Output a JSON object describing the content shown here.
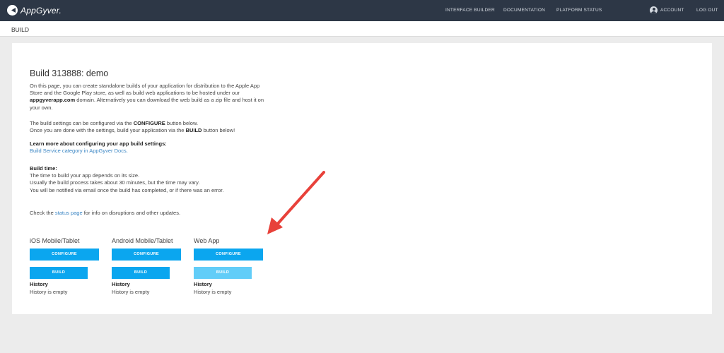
{
  "header": {
    "logo_text": "AppGyver.",
    "nav": {
      "interface_builder": "INTERFACE BUILDER",
      "documentation": "DOCUMENTATION",
      "platform_status": "PLATFORM STATUS",
      "account": "ACCOUNT",
      "logout": "LOG OUT"
    }
  },
  "subheader": {
    "title": "BUILD"
  },
  "main": {
    "title": "Build 313888: demo",
    "intro": {
      "text1": "On this page, you can create standalone builds of your application for distribution to the Apple App Store and the Google Play store, as well as build web applications to be hosted under our ",
      "bold": "appgyverapp.com",
      "text2": " domain. Alternatively you can download the web build as a zip file and host it on your own."
    },
    "settings": {
      "line1_pre": "The build settings can be configured via the ",
      "line1_bold": "CONFIGURE",
      "line1_post": " button below.",
      "line2_pre": "Once you are done with the settings, build your application via the ",
      "line2_bold": "BUILD",
      "line2_post": " button below!"
    },
    "learn": {
      "heading": "Learn more about configuring your app build settings:",
      "link": "Build Service category in AppGyver Docs."
    },
    "build_time": {
      "heading": "Build time:",
      "line1": "The time to build your app depends on its size.",
      "line2": "Usually the build process takes about 30 minutes, but the time may vary.",
      "line3": "You will be notified via email once the build has completed, or if there was an error."
    },
    "status": {
      "pre": "Check the ",
      "link": "status page",
      "post": " for info on disruptions and other updates."
    },
    "platforms": [
      {
        "title": "iOS Mobile/Tablet",
        "configure": "CONFIGURE",
        "build": "BUILD",
        "history_heading": "History",
        "history_text": "History is empty"
      },
      {
        "title": "Android Mobile/Tablet",
        "configure": "CONFIGURE",
        "build": "BUILD",
        "history_heading": "History",
        "history_text": "History is empty"
      },
      {
        "title": "Web App",
        "configure": "CONFIGURE",
        "build": "BUILD",
        "history_heading": "History",
        "history_text": "History is empty"
      }
    ]
  },
  "colors": {
    "topbar": "#2d3746",
    "button": "#0ba6ef",
    "button_disabled": "#62cdf8",
    "link": "#3b86c4",
    "annotation_arrow": "#e8413a"
  },
  "icons": {
    "logo": "appgyver-logo-icon",
    "account": "user-circle-icon",
    "annotation": "red-arrow-icon"
  }
}
